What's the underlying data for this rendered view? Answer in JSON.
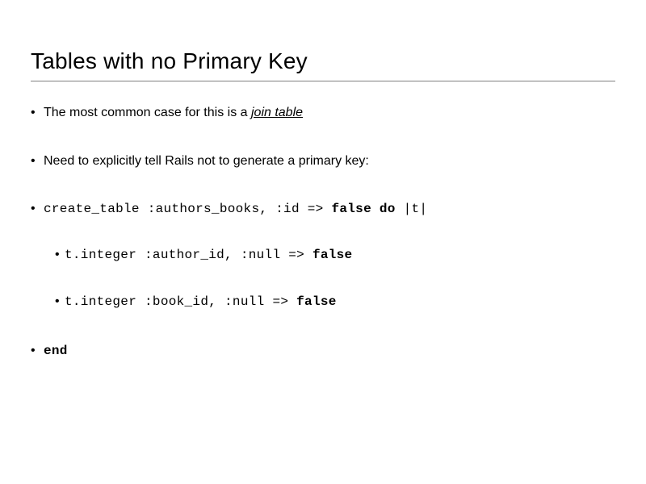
{
  "title": "Tables with no Primary Key",
  "bullets": {
    "b1_pre": "The most common case for this is a ",
    "b1_em": "join table",
    "b2": "Need to explicitly tell Rails not to generate a primary key:",
    "b3": {
      "code_pre": "create_table :authors_books, :id => ",
      "kw_false": "false",
      "space1": " ",
      "kw_do": "do",
      "code_post": " |t|"
    },
    "b3_sub1": {
      "code_pre": "t.integer :author_id, :null => ",
      "kw_false": "false"
    },
    "b3_sub2": {
      "code_pre": "t.integer :book_id, :null => ",
      "kw_false": "false"
    },
    "b4": {
      "kw_end": "end"
    }
  }
}
